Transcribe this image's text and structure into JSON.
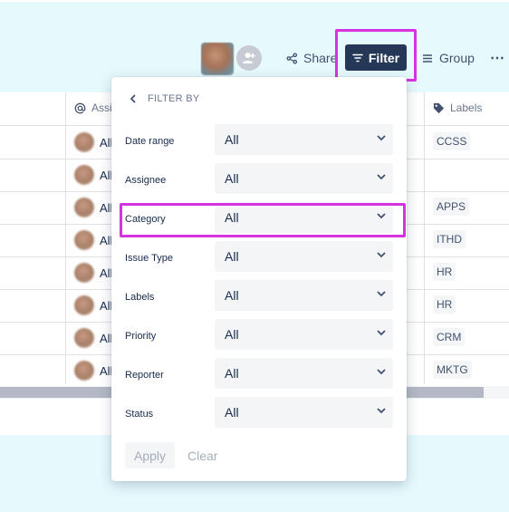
{
  "toolbar": {
    "share_label": "Share",
    "filter_label": "Filter",
    "group_label": "Group",
    "more_label": "⋯"
  },
  "table": {
    "assignee_header": "Assi",
    "labels_header": "Labels",
    "rows": [
      {
        "assignee": "All",
        "label": "CCSS"
      },
      {
        "assignee": "All",
        "label": ""
      },
      {
        "assignee": "All",
        "label": "APPS"
      },
      {
        "assignee": "All",
        "label": "ITHD"
      },
      {
        "assignee": "All",
        "label": "HR"
      },
      {
        "assignee": "All",
        "label": "HR"
      },
      {
        "assignee": "All",
        "label": "CRM"
      },
      {
        "assignee": "All",
        "label": "MKTG"
      }
    ]
  },
  "filter_panel": {
    "title": "FILTER BY",
    "filters": [
      {
        "label": "Date range",
        "value": "All"
      },
      {
        "label": "Assignee",
        "value": "All"
      },
      {
        "label": "Category",
        "value": "All"
      },
      {
        "label": "Issue Type",
        "value": "All"
      },
      {
        "label": "Labels",
        "value": "All"
      },
      {
        "label": "Priority",
        "value": "All"
      },
      {
        "label": "Reporter",
        "value": "All"
      },
      {
        "label": "Status",
        "value": "All"
      }
    ],
    "apply_label": "Apply",
    "clear_label": "Clear"
  },
  "colors": {
    "page_background": "#e6fafd",
    "filter_button": "#253858",
    "highlight": "#d633e0",
    "select_background": "#f4f5f7"
  },
  "icons": [
    "share-icon",
    "filter-icon",
    "group-icon",
    "more-icon",
    "add-person-icon",
    "at-icon",
    "tag-icon",
    "chevron-left-icon",
    "chevron-down-icon"
  ]
}
